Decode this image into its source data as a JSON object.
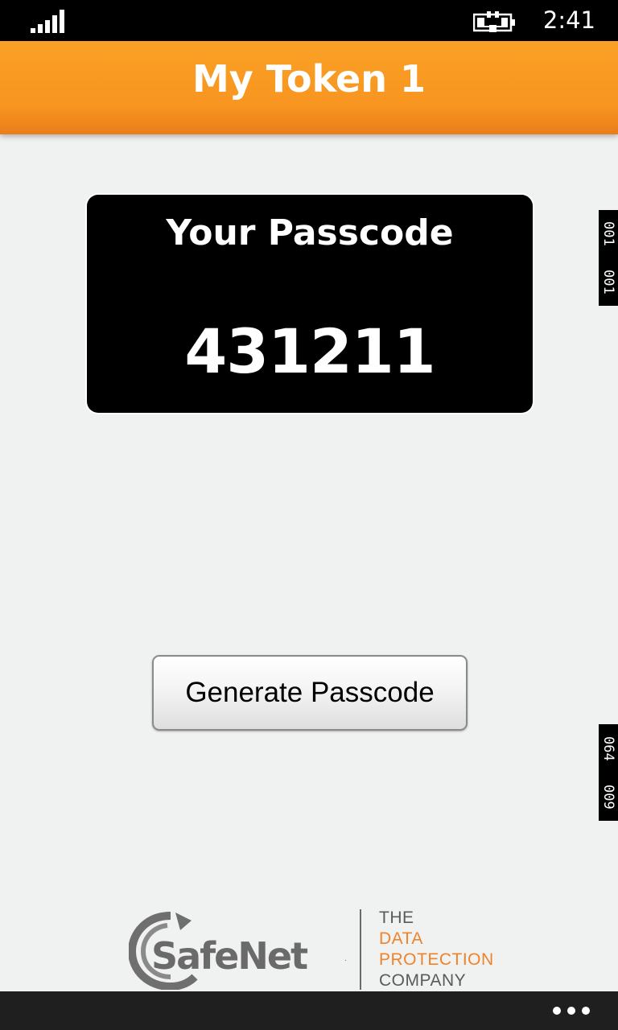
{
  "status_bar": {
    "time": "2:41",
    "signal_icon": "signal-strength-icon",
    "battery_icon": "battery-charging-icon"
  },
  "header": {
    "title": "My Token 1"
  },
  "passcode_card": {
    "heading": "Your Passcode",
    "value": "431211"
  },
  "side_tags": {
    "top": [
      "001",
      "001"
    ],
    "bottom": [
      "064",
      "009"
    ]
  },
  "actions": {
    "generate_label": "Generate Passcode"
  },
  "logo": {
    "brand": "SafeNet",
    "tagline": [
      "THE",
      "DATA",
      "PROTECTION",
      "COMPANY"
    ]
  },
  "app_bar": {
    "more_icon": "ellipsis-icon"
  },
  "colors": {
    "accent": "#f79520",
    "tagline_orange": "#f0822a"
  }
}
